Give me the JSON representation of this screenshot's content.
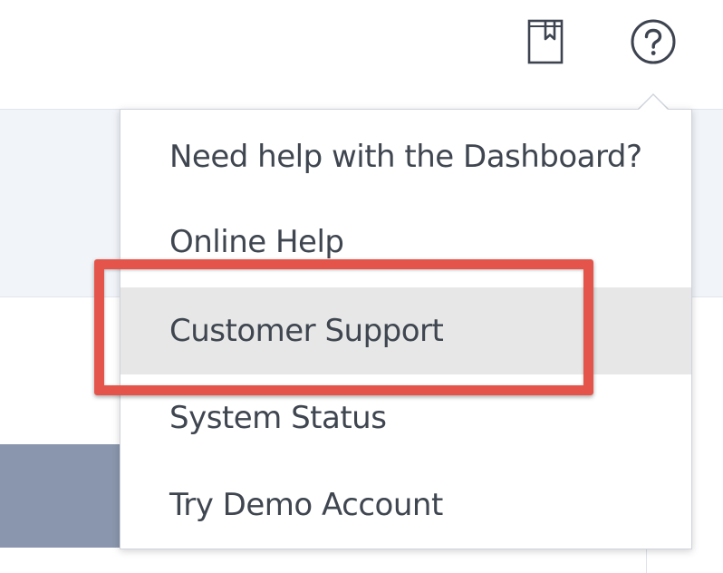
{
  "header": {
    "bookmark_icon": "bookmark-icon",
    "help_icon": "help-circle-icon"
  },
  "help_menu": {
    "heading": "Need help with the Dashboard?",
    "items": [
      {
        "label": "Online Help"
      },
      {
        "label": "Customer Support",
        "hovered": true
      },
      {
        "label": "System Status"
      },
      {
        "label": "Try Demo Account"
      }
    ]
  },
  "colors": {
    "highlight_border": "#e4544a",
    "hover_background": "#e6e7e6",
    "menu_text": "#3f4650",
    "icon_stroke": "#3d4450",
    "band_background": "#f1f4f9",
    "block_background": "#8a96ad"
  }
}
